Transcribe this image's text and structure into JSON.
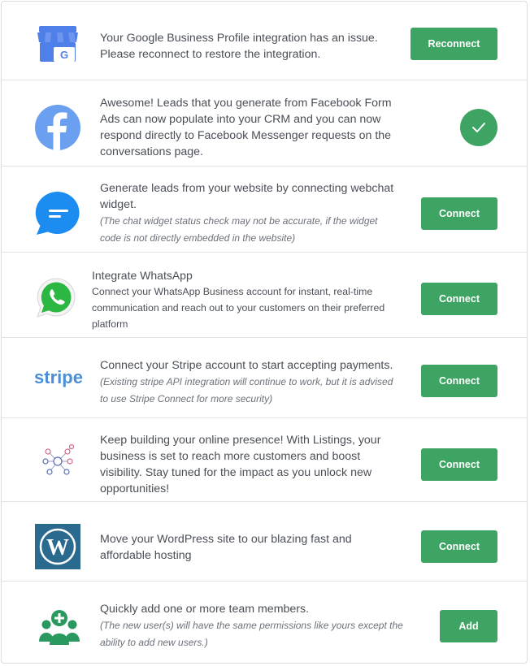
{
  "integrations": [
    {
      "name": "google-business",
      "icon": "google-business-store-icon",
      "text": "Your Google Business Profile integration has an issue. Please reconnect to restore the integration.",
      "button": "Reconnect"
    },
    {
      "name": "facebook",
      "icon": "facebook-icon",
      "text": "Awesome! Leads that you generate from Facebook Form Ads can now populate into your CRM and you can now respond directly to Facebook Messenger requests on the conversations page.",
      "status": "connected-check-icon"
    },
    {
      "name": "webchat",
      "icon": "chat-bubble-icon",
      "text": "Generate leads from your website by connecting webchat widget.",
      "note": "(The chat widget status check may not be accurate, if the widget code is not directly embedded in the website)",
      "button": "Connect"
    },
    {
      "name": "whatsapp",
      "icon": "whatsapp-icon",
      "title": "Integrate WhatsApp",
      "text": "Connect your WhatsApp Business account for instant, real-time communication and reach out to your customers on their preferred platform",
      "button": "Connect"
    },
    {
      "name": "stripe",
      "icon": "stripe-logo",
      "logo_text": "stripe",
      "text": "Connect your Stripe account to start accepting payments.",
      "note": "(Existing stripe API integration will continue to work, but it is advised to use Stripe Connect for more security)",
      "button": "Connect"
    },
    {
      "name": "listings",
      "icon": "network-nodes-icon",
      "text": "Keep building your online presence! With Listings, your business is set to reach more customers and boost visibility. Stay tuned for the impact as you unlock new opportunities!",
      "button": "Connect"
    },
    {
      "name": "wordpress",
      "icon": "wordpress-icon",
      "text": "Move your WordPress site to our blazing fast and affordable hosting",
      "button": "Connect"
    },
    {
      "name": "team",
      "icon": "add-team-members-icon",
      "text": "Quickly add one or more team members.",
      "note": "(The new user(s) will have the same permissions like yours except the ability to add new users.)",
      "button": "Add"
    }
  ],
  "colors": {
    "accent": "#3ea463",
    "facebook": "#6b9ff0",
    "chat": "#1d8cf0",
    "whatsapp": "#2bb741",
    "stripe": "#4a8fd6",
    "wordpress": "#2b6a8f",
    "team": "#2a9960"
  }
}
